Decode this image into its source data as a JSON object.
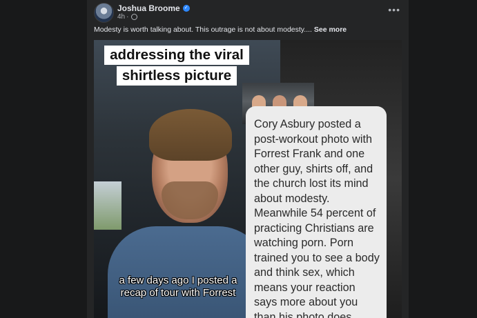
{
  "post": {
    "author": "Joshua Broome",
    "time": "4h",
    "dot": "·",
    "caption": "Modesty is worth talking about. This outrage is not about modesty.... ",
    "see_more": "See more",
    "menu": "•••"
  },
  "media": {
    "title_lines": [
      "addressing the viral",
      "shirtless picture"
    ],
    "subtitle_lines": [
      "a few days ago I posted a",
      "recap of tour with Forrest"
    ],
    "quote": "Cory Asbury posted a post-workout photo with Forrest Frank and one other guy, shirts off, and the church lost its mind about modesty. Meanwhile 54 percent of practicing Christians are watching porn. Porn trained you to see a body and think sex, which means your reaction says more about you than his photo does."
  },
  "colors": {
    "page_bg": "#18191a",
    "card_bg": "#242526",
    "text_primary": "#e4e6eb",
    "text_secondary": "#b0b3b8",
    "verified": "#2d88ff"
  },
  "icons": [
    "verified-badge-icon",
    "globe-icon",
    "more-options-icon"
  ]
}
